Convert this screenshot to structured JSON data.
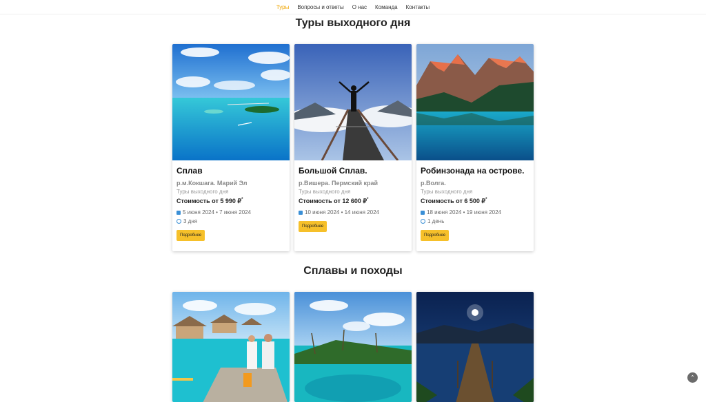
{
  "nav": {
    "items": [
      {
        "label": "Туры",
        "active": true
      },
      {
        "label": "Вопросы и ответы",
        "active": false
      },
      {
        "label": "О нас",
        "active": false
      },
      {
        "label": "Команда",
        "active": false
      },
      {
        "label": "Контакты",
        "active": false
      }
    ]
  },
  "sections": [
    {
      "title": "Туры выходного дня",
      "cards": [
        {
          "title": "Сплав",
          "location": "р.м.Кокшага. Марий Эл",
          "category": "Туры выходного дня",
          "price": "Стоимость от 5 990 ₽",
          "price_mark": "*",
          "dates": "5 июня 2024 • 7 июня 2024",
          "duration": "3 дня",
          "button": "Подробнее"
        },
        {
          "title": "Большой Сплав.",
          "location": "р.Вишера. Пермский край",
          "category": "Туры выходного дня",
          "price": "Стоимость от 12 600 ₽",
          "price_mark": "*",
          "dates": "10 июня 2024 • 14 июня 2024",
          "duration": "",
          "button": "Подробнее"
        },
        {
          "title": "Робинзонада на острове.",
          "location": "р.Волга.",
          "category": "Туры выходного дня",
          "price": "Стоимость от 6 500 ₽",
          "price_mark": "*",
          "dates": "18 июня 2024 • 19 июня 2024",
          "duration": "1 день",
          "button": "Подробнее"
        }
      ]
    },
    {
      "title": "Сплавы и походы",
      "cards": []
    }
  ],
  "icons": {
    "calendar": "calendar-icon",
    "clock": "clock-icon",
    "scroll_top": "chevron-up-icon"
  },
  "scroll_top_glyph": "⌃",
  "colors": {
    "accent": "#f0a500",
    "button": "#f6c02a",
    "icon": "#3a8fd6"
  }
}
